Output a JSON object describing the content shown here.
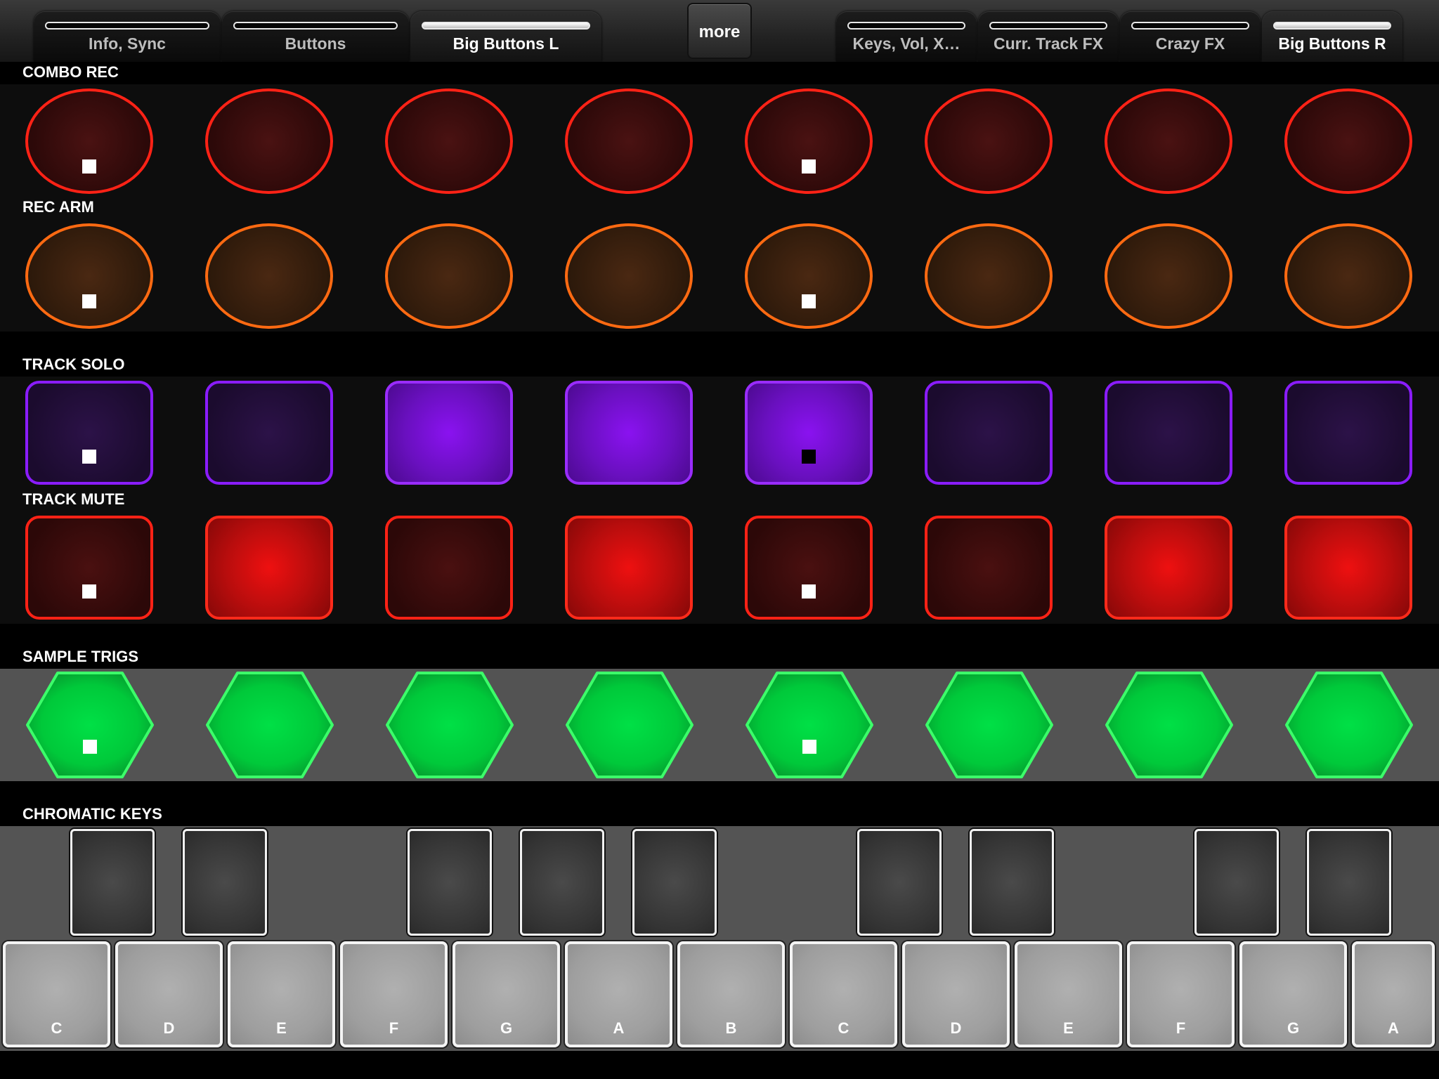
{
  "tabs_left": [
    {
      "label": "Info, Sync",
      "active": false
    },
    {
      "label": "Buttons",
      "active": false
    },
    {
      "label": "Big Buttons L",
      "active": true
    }
  ],
  "more_label": "more",
  "tabs_right": [
    {
      "label": "Keys, Vol, X…",
      "active": false
    },
    {
      "label": "Curr. Track FX",
      "active": false
    },
    {
      "label": "Crazy FX",
      "active": false
    },
    {
      "label": "Big Buttons R",
      "active": true
    }
  ],
  "sections": {
    "combo_rec": {
      "label": "COMBO REC",
      "pads": [
        {
          "lit": false,
          "marker": "white"
        },
        {
          "lit": false,
          "marker": "none"
        },
        {
          "lit": false,
          "marker": "none"
        },
        {
          "lit": false,
          "marker": "none"
        },
        {
          "lit": false,
          "marker": "white"
        },
        {
          "lit": false,
          "marker": "none"
        },
        {
          "lit": false,
          "marker": "none"
        },
        {
          "lit": false,
          "marker": "none"
        }
      ]
    },
    "rec_arm": {
      "label": "REC ARM",
      "pads": [
        {
          "lit": false,
          "marker": "white"
        },
        {
          "lit": false,
          "marker": "none"
        },
        {
          "lit": false,
          "marker": "none"
        },
        {
          "lit": false,
          "marker": "none"
        },
        {
          "lit": false,
          "marker": "white"
        },
        {
          "lit": false,
          "marker": "none"
        },
        {
          "lit": false,
          "marker": "none"
        },
        {
          "lit": false,
          "marker": "none"
        }
      ]
    },
    "track_solo": {
      "label": "TRACK SOLO",
      "pads": [
        {
          "lit": false,
          "marker": "white"
        },
        {
          "lit": false,
          "marker": "none"
        },
        {
          "lit": true,
          "marker": "none"
        },
        {
          "lit": true,
          "marker": "none"
        },
        {
          "lit": true,
          "marker": "black"
        },
        {
          "lit": false,
          "marker": "none"
        },
        {
          "lit": false,
          "marker": "none"
        },
        {
          "lit": false,
          "marker": "none"
        }
      ]
    },
    "track_mute": {
      "label": "TRACK MUTE",
      "pads": [
        {
          "lit": false,
          "marker": "white"
        },
        {
          "lit": true,
          "marker": "none"
        },
        {
          "lit": false,
          "marker": "none"
        },
        {
          "lit": true,
          "marker": "none"
        },
        {
          "lit": false,
          "marker": "white"
        },
        {
          "lit": false,
          "marker": "none"
        },
        {
          "lit": true,
          "marker": "none"
        },
        {
          "lit": true,
          "marker": "none"
        }
      ]
    },
    "sample_trigs": {
      "label": "SAMPLE TRIGS",
      "pads": [
        {
          "lit": true,
          "marker": "white"
        },
        {
          "lit": true,
          "marker": "none"
        },
        {
          "lit": true,
          "marker": "none"
        },
        {
          "lit": true,
          "marker": "none"
        },
        {
          "lit": true,
          "marker": "white"
        },
        {
          "lit": true,
          "marker": "none"
        },
        {
          "lit": true,
          "marker": "none"
        },
        {
          "lit": true,
          "marker": "none"
        }
      ]
    },
    "chromatic_keys": {
      "label": "CHROMATIC KEYS",
      "white_keys": [
        "C",
        "D",
        "E",
        "F",
        "G",
        "A",
        "B",
        "C",
        "D",
        "E",
        "F",
        "G",
        "A"
      ],
      "black_key_count": 9
    }
  },
  "colors": {
    "rec_outline": "#ff2216",
    "arm_outline": "#ff6a12",
    "solo_outline": "#8a1cff",
    "mute_outline": "#ff2216",
    "trig_fill": "#00d23c",
    "trig_outline": "#3cff6a"
  }
}
